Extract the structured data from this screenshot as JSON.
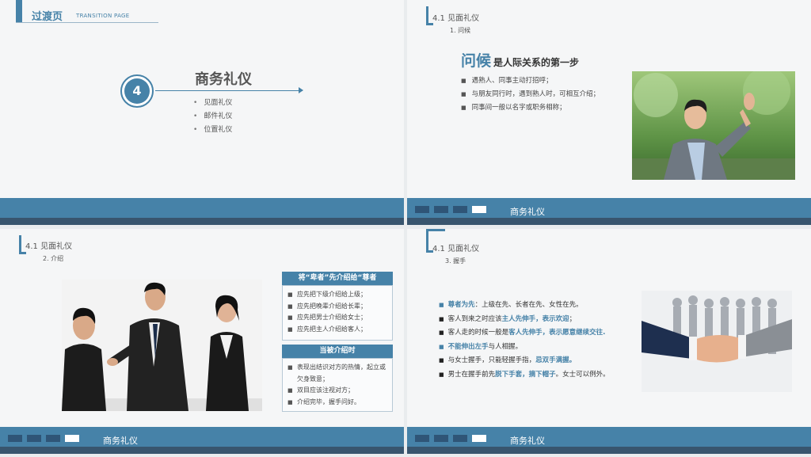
{
  "slide1": {
    "title": "过渡页",
    "subtitle": "TRANSITION PAGE",
    "number": "4",
    "heading": "商务礼仪",
    "items": [
      "见面礼仪",
      "邮件礼仪",
      "位置礼仪"
    ]
  },
  "slide2": {
    "section": "4.1  见面礼仪",
    "subsection": "1. 问候",
    "title_big": "问候",
    "title_rest": "是人际关系的第一步",
    "bullets": [
      "遇熟人、同事主动打招呼；",
      "与朋友同行时，遇到熟人时，可相互介绍；",
      "同事间一般以名字或职务相称；"
    ]
  },
  "slide3": {
    "section": "4.1  见面礼仪",
    "subsection": "2. 介绍",
    "box1_title": "将“卑者”先介绍给“尊者",
    "box1_items": [
      "应先把下级介绍给上级；",
      "应先把晚辈介绍给长辈；",
      "应先把男士介绍给女士；",
      "应先把主人介绍给客人；"
    ],
    "box2_title": "当被介绍时",
    "box2_items": [
      "表现出结识对方的热情，起立或欠身致意；",
      "双目应该注视对方；",
      "介绍完毕，握手问好。"
    ]
  },
  "slide4": {
    "section": "4.1  见面礼仪",
    "subsection": "3. 握手",
    "lines": [
      {
        "hl1": "尊者为先",
        "t1": "：上级在先、长者在先、女性在先。",
        "hl2": "",
        "t2": "",
        "hl3": "",
        "t3": ""
      },
      {
        "hl1": "",
        "t1": "客人到来之时应该",
        "hl2": "主人先伸手，表示欢迎",
        "t2": "；",
        "hl3": "",
        "t3": ""
      },
      {
        "hl1": "",
        "t1": "客人走的时候一般是",
        "hl2": "客人先伸手，表示愿意继续交往.",
        "t2": "",
        "hl3": "",
        "t3": ""
      },
      {
        "hl1": "不能伸出左手",
        "t1": "与人相握。",
        "hl2": "",
        "t2": "",
        "hl3": "",
        "t3": ""
      },
      {
        "hl1": "",
        "t1": "与女士握手，只能轻握手指，",
        "hl2": "忌双手满握。",
        "t2": "",
        "hl3": "",
        "t3": ""
      },
      {
        "hl1": "",
        "t1": "男士在握手前先",
        "hl2": "脱下手套，摘下帽子",
        "t2": "。女士可以例外。",
        "hl3": "",
        "t3": ""
      }
    ]
  },
  "footer": {
    "label": "商务礼仪"
  },
  "colors": {
    "accent": "#4682a8",
    "footer_dark": "#38556e"
  }
}
